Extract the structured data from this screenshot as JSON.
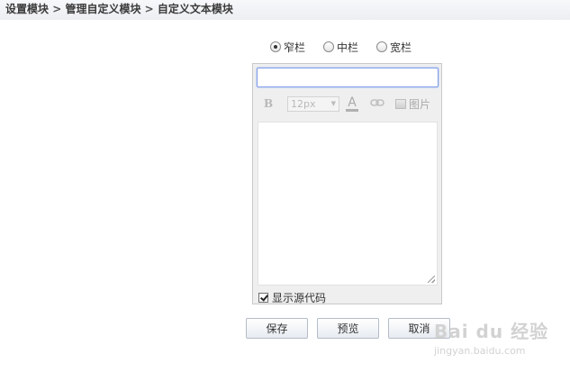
{
  "breadcrumb": {
    "item1": "设置模块",
    "item2": "管理自定义模块",
    "item3": "自定义文本模块",
    "separator": ">"
  },
  "width_options": {
    "selected": "窄栏",
    "options": [
      "窄栏",
      "中栏",
      "宽栏"
    ]
  },
  "editor": {
    "title_value": "",
    "toolbar": {
      "bold_icon": "B",
      "font_size": "12px",
      "font_color_icon": "A",
      "link_icon": "link-icon",
      "image_label": "图片"
    },
    "content_value": "",
    "show_source": {
      "label": "显示源代码",
      "checked": true
    }
  },
  "actions": {
    "save": "保存",
    "preview": "预览",
    "cancel": "取消"
  },
  "watermark": {
    "logo": "Bai du 经验",
    "url": "jingyan.baidu.com"
  },
  "colors": {
    "breadcrumb_bg": "#eceef2",
    "input_focus_border": "#7d9be6",
    "editor_bg": "#efefef"
  }
}
